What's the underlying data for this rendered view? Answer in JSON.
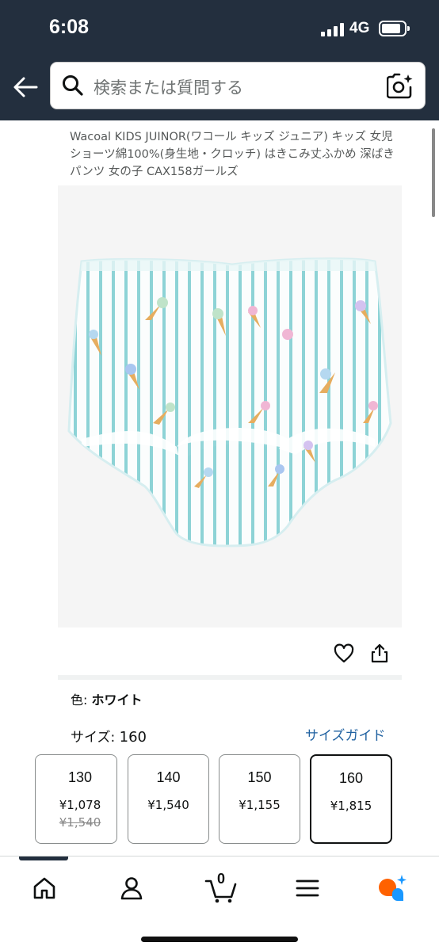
{
  "status_bar": {
    "time": "6:08",
    "network": "4G"
  },
  "search": {
    "placeholder": "検索または質問する"
  },
  "product": {
    "title": "Wacoal KIDS JUINOR(ワコール キッズ ジュニア) キッズ 女児ショーツ綿100%(身生地・クロッチ) はきこみ丈ふかめ 深ばき パンツ 女の子 CAX158ガールズ"
  },
  "options": {
    "color_label": "色: ",
    "color_value": "ホワイト",
    "size_label": "サイズ: ",
    "size_value": "160",
    "size_guide": "サイズガイド",
    "sizes": [
      {
        "size": "130",
        "price": "¥1,078",
        "old_price": "¥1,540"
      },
      {
        "size": "140",
        "price": "¥1,540"
      },
      {
        "size": "150",
        "price": "¥1,155"
      },
      {
        "size": "160",
        "price": "¥1,815",
        "selected": true
      }
    ]
  },
  "nav": {
    "icons": [
      "home-icon",
      "account-icon",
      "cart-icon",
      "menu-icon",
      "rufus-icon"
    ],
    "cart_count": "0"
  },
  "colors": {
    "header_bg": "#232f3e",
    "link": "#2162a1",
    "text": "#0f1111",
    "accent_orange": "#ff6200",
    "accent_blue": "#1a98ff"
  }
}
